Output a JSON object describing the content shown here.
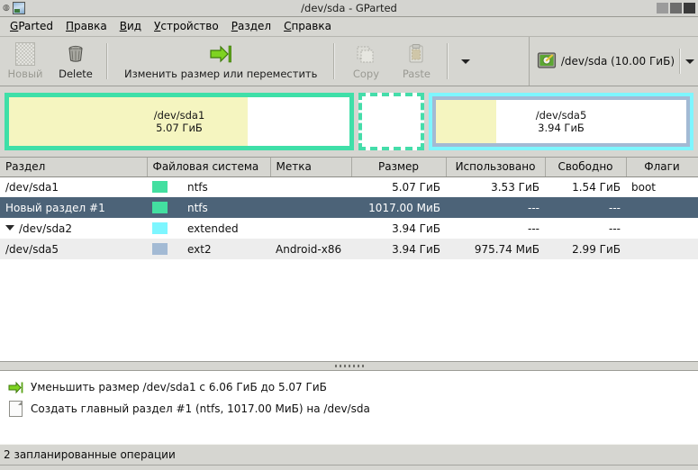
{
  "window": {
    "title": "/dev/sda - GParted",
    "app_icon": "gparted-icon",
    "buttons": [
      "minimize-button",
      "maximize-button",
      "close-button"
    ]
  },
  "menubar": {
    "items": [
      {
        "label": "GParted",
        "mnemonic": "G"
      },
      {
        "label": "Правка",
        "mnemonic": "П"
      },
      {
        "label": "Вид",
        "mnemonic": "В"
      },
      {
        "label": "Устройство",
        "mnemonic": "У"
      },
      {
        "label": "Раздел",
        "mnemonic": "Р"
      },
      {
        "label": "Справка",
        "mnemonic": "С"
      }
    ]
  },
  "toolbar": {
    "new_label": "Новый",
    "delete_label": "Delete",
    "resize_label": "Изменить размер или переместить",
    "copy_label": "Copy",
    "paste_label": "Paste",
    "overflow_icon": "chevron-down-icon",
    "device_label": "/dev/sda  (10.00 ГиБ)",
    "device_icon": "harddisk-icon",
    "device_dropdown_icon": "chevron-down-icon"
  },
  "graphic": {
    "partitions": [
      {
        "name": "/dev/sda1",
        "size": "5.07 ГиБ",
        "border_color": "#3fdfa8",
        "used_percent": 70,
        "style": "solid"
      },
      {
        "name": "",
        "size": "",
        "border_color": "#45ddaa",
        "used_percent": 0,
        "style": "dashed"
      },
      {
        "name": "/dev/sda5",
        "size": "3.94 ГиБ",
        "border_color": "#7df6ff",
        "inner_border_color": "#a3bad4",
        "used_percent": 24,
        "style": "extended"
      }
    ],
    "used_fill_color": "#f5f5c0",
    "free_fill_color": "#ffffff"
  },
  "table": {
    "headers": [
      "Раздел",
      "Файловая система",
      "Метка",
      "Размер",
      "Использовано",
      "Свободно",
      "Флаги"
    ],
    "rows": [
      {
        "partition": "/dev/sda1",
        "fs": "ntfs",
        "fs_color": "#43dfa0",
        "label": "",
        "size": "5.07 ГиБ",
        "used": "3.53 ГиБ",
        "free": "1.54 ГиБ",
        "flags": "boot",
        "indent": 1,
        "expander": false,
        "selected": false,
        "alt": false
      },
      {
        "partition": "Новый раздел #1",
        "fs": "ntfs",
        "fs_color": "#43dfa0",
        "label": "",
        "size": "1017.00 МиБ",
        "used": "---",
        "free": "---",
        "flags": "",
        "indent": 1,
        "expander": false,
        "selected": true,
        "alt": false
      },
      {
        "partition": "/dev/sda2",
        "fs": "extended",
        "fs_color": "#7df6ff",
        "label": "",
        "size": "3.94 ГиБ",
        "used": "---",
        "free": "---",
        "flags": "",
        "indent": 0,
        "expander": true,
        "selected": false,
        "alt": false
      },
      {
        "partition": "/dev/sda5",
        "fs": "ext2",
        "fs_color": "#a3bad4",
        "label": "Android-x86",
        "size": "3.94 ГиБ",
        "used": "975.74 МиБ",
        "free": "2.99 ГиБ",
        "flags": "",
        "indent": 2,
        "expander": false,
        "selected": false,
        "alt": true
      }
    ]
  },
  "operations": {
    "items": [
      {
        "icon": "resize-arrow-icon",
        "text": "Уменьшить размер /dev/sda1 с 6.06 ГиБ до 5.07 ГиБ"
      },
      {
        "icon": "new-document-icon",
        "text": "Создать главный раздел #1 (ntfs, 1017.00 МиБ) на /dev/sda"
      }
    ]
  },
  "statusbar": {
    "text": "2 запланированные операции"
  }
}
